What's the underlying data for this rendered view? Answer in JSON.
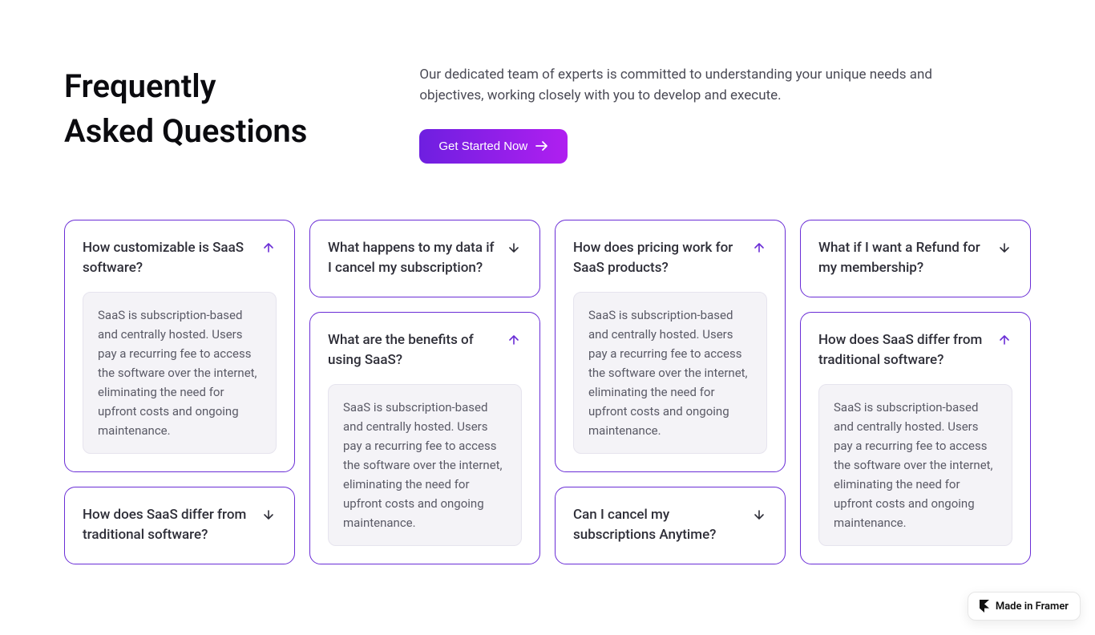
{
  "header": {
    "title_line1": "Frequently",
    "title_line2": "Asked Questions",
    "description": "Our dedicated team of experts is committed to understanding your unique needs and objectives, working closely with you to develop and execute.",
    "cta_label": "Get Started Now"
  },
  "faq": {
    "common_answer": "SaaS is subscription-based and centrally hosted. Users pay a recurring fee to access the software over the internet, eliminating the need for upfront costs and ongoing maintenance.",
    "columns": [
      [
        {
          "q": "How customizable is SaaS software?",
          "expanded": true
        },
        {
          "q": "How does SaaS differ from traditional software?",
          "expanded": false
        }
      ],
      [
        {
          "q": "What happens to my data if I cancel my subscription?",
          "expanded": false
        },
        {
          "q": "What are the benefits of using SaaS?",
          "expanded": true
        }
      ],
      [
        {
          "q": "How does pricing work for SaaS products?",
          "expanded": true
        },
        {
          "q": "Can I cancel my subscriptions Anytime?",
          "expanded": false
        }
      ],
      [
        {
          "q": "What if I want a Refund for my membership?",
          "expanded": false
        },
        {
          "q": "How does SaaS differ from traditional software?",
          "expanded": true
        }
      ]
    ]
  },
  "badge": {
    "label": "Made in Framer"
  },
  "colors": {
    "accent_start": "#6e1fe0",
    "accent_end": "#b01ff0",
    "card_border": "#6a2dd6",
    "text_dark": "#0b0b0f",
    "text_muted": "#5a5a66",
    "answer_bg": "#f4f3f7"
  }
}
